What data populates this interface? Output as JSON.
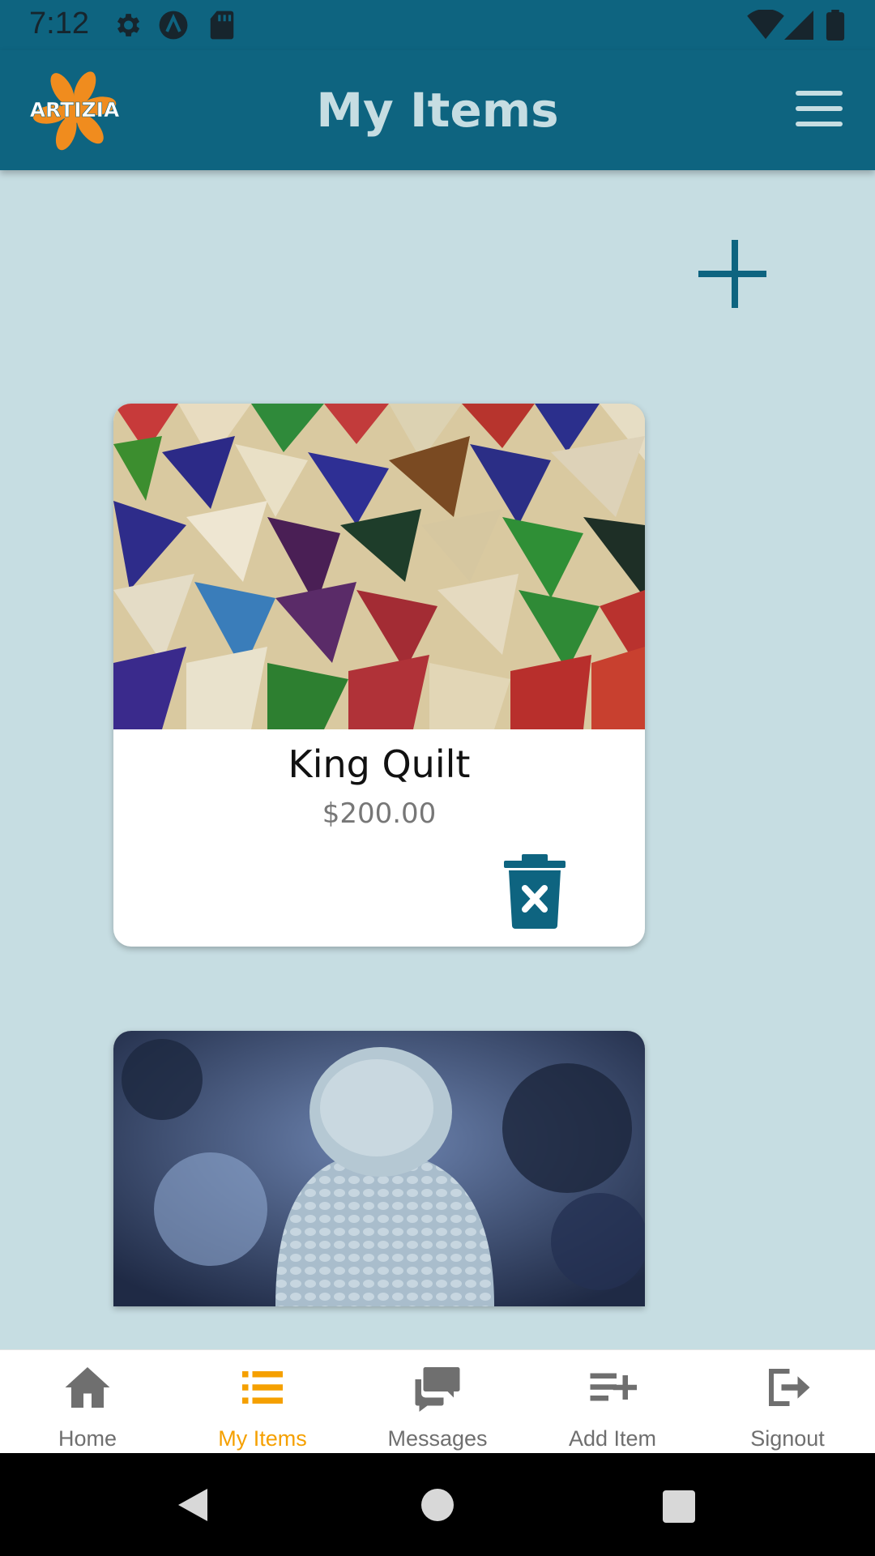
{
  "status_bar": {
    "time": "7:12",
    "icons": [
      "gear-icon",
      "a-badge-icon",
      "sd-card-icon",
      "wifi-icon",
      "signal-icon",
      "battery-icon"
    ]
  },
  "app_bar": {
    "logo_text": "ARTIZIA",
    "title": "My Items",
    "menu_icon": "hamburger-menu-icon"
  },
  "colors": {
    "primary": "#0e6480",
    "background": "#c6dde2",
    "accent": "#f5a000",
    "logo_orange": "#f08c1e"
  },
  "main": {
    "add_icon": "plus-icon",
    "items": [
      {
        "name": "King Quilt",
        "price": "$200.00",
        "image": "patchwork-quilt-photo",
        "delete_icon": "trash-delete-icon"
      },
      {
        "image": "knit-beanie-photo"
      }
    ]
  },
  "bottom_nav": {
    "items": [
      {
        "label": "Home",
        "icon": "home-icon"
      },
      {
        "label": "My Items",
        "icon": "list-icon",
        "active": true
      },
      {
        "label": "Messages",
        "icon": "chat-bubbles-icon"
      },
      {
        "label": "Add Item",
        "icon": "playlist-add-icon"
      },
      {
        "label": "Signout",
        "icon": "signout-icon"
      }
    ]
  },
  "system_nav": {
    "buttons": [
      "back-icon",
      "home-circle-icon",
      "recents-square-icon"
    ]
  }
}
